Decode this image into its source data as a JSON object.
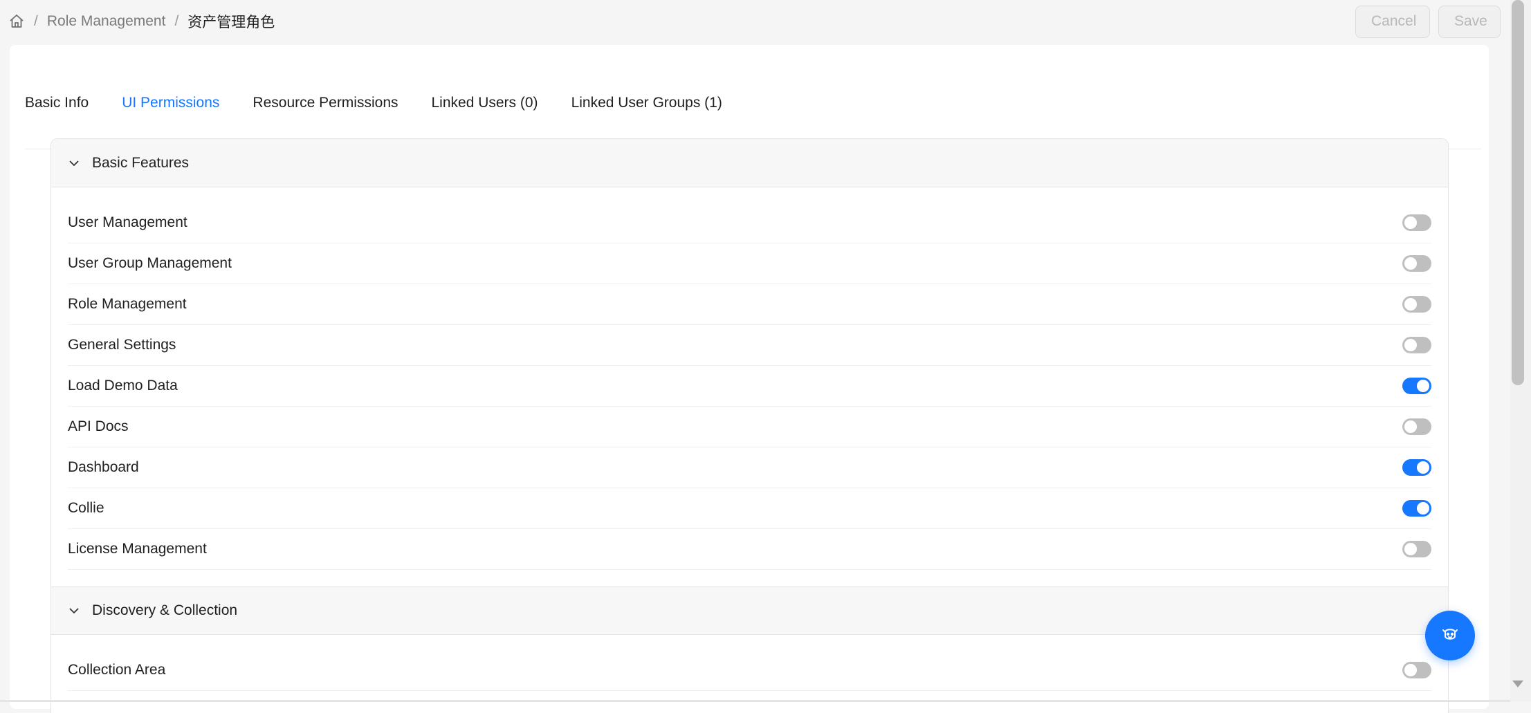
{
  "breadcrumb": {
    "home_icon": "home-icon",
    "separator": "/",
    "items": [
      "Role Management",
      "资产管理角色"
    ]
  },
  "actions": {
    "cancel_label": "Cancel",
    "save_label": "Save"
  },
  "tabs": [
    {
      "label": "Basic Info",
      "active": false
    },
    {
      "label": "UI Permissions",
      "active": true
    },
    {
      "label": "Resource Permissions",
      "active": false
    },
    {
      "label": "Linked Users (0)",
      "active": false
    },
    {
      "label": "Linked User Groups (1)",
      "active": false
    }
  ],
  "panels": [
    {
      "title": "Basic Features",
      "expanded": true,
      "items": [
        {
          "label": "User Management",
          "enabled": false
        },
        {
          "label": "User Group Management",
          "enabled": false
        },
        {
          "label": "Role Management",
          "enabled": false
        },
        {
          "label": "General Settings",
          "enabled": false
        },
        {
          "label": "Load Demo Data",
          "enabled": true
        },
        {
          "label": "API Docs",
          "enabled": false
        },
        {
          "label": "Dashboard",
          "enabled": true
        },
        {
          "label": "Collie",
          "enabled": true
        },
        {
          "label": "License Management",
          "enabled": false
        }
      ]
    },
    {
      "title": "Discovery & Collection",
      "expanded": true,
      "items": [
        {
          "label": "Collection Area",
          "enabled": false
        }
      ]
    }
  ],
  "fab_icon": "bot-icon",
  "colors": {
    "primary": "#1677ff",
    "switch_off": "#bfbfbf"
  }
}
